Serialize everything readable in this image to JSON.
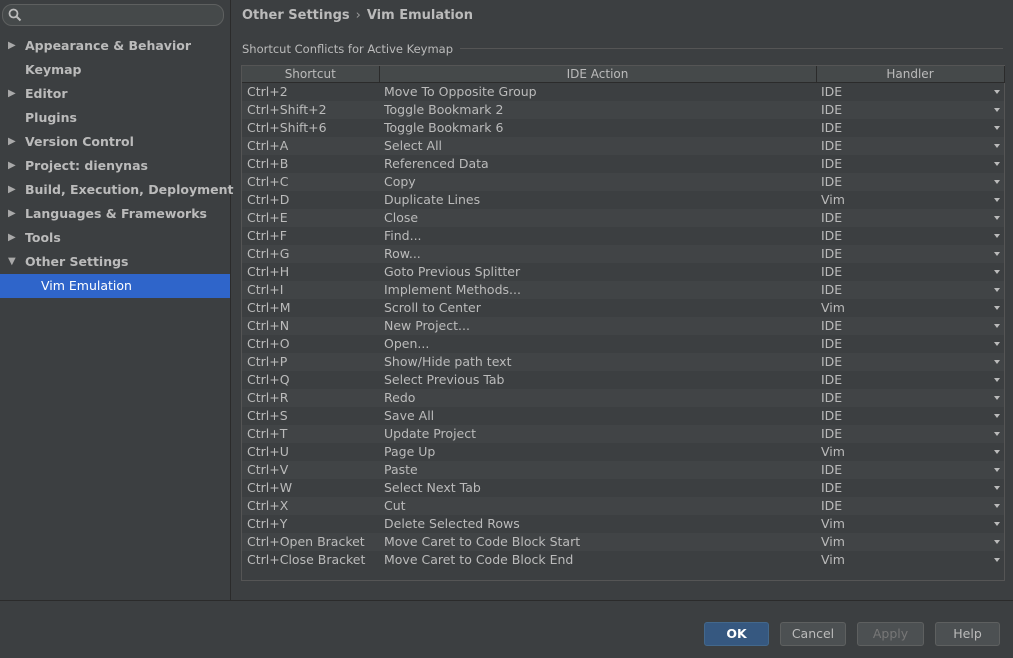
{
  "sidebar": {
    "items": [
      {
        "label": "Appearance & Behavior",
        "arrow": "▶"
      },
      {
        "label": "Keymap",
        "arrow": ""
      },
      {
        "label": "Editor",
        "arrow": "▶"
      },
      {
        "label": "Plugins",
        "arrow": ""
      },
      {
        "label": "Version Control",
        "arrow": "▶"
      },
      {
        "label": "Project: dienynas",
        "arrow": "▶"
      },
      {
        "label": "Build, Execution, Deployment",
        "arrow": "▶"
      },
      {
        "label": "Languages & Frameworks",
        "arrow": "▶"
      },
      {
        "label": "Tools",
        "arrow": "▶"
      },
      {
        "label": "Other Settings",
        "arrow": "▼"
      },
      {
        "label": "Vim Emulation",
        "arrow": ""
      }
    ]
  },
  "breadcrumb": {
    "parent": "Other Settings",
    "separator": "›",
    "current": "Vim Emulation"
  },
  "section_title": "Shortcut Conflicts for Active Keymap",
  "table": {
    "headers": {
      "shortcut": "Shortcut",
      "action": "IDE Action",
      "handler": "Handler"
    },
    "rows": [
      {
        "shortcut": "Ctrl+2",
        "action": "Move To Opposite Group",
        "handler": "IDE"
      },
      {
        "shortcut": "Ctrl+Shift+2",
        "action": "Toggle Bookmark 2",
        "handler": "IDE"
      },
      {
        "shortcut": "Ctrl+Shift+6",
        "action": "Toggle Bookmark 6",
        "handler": "IDE"
      },
      {
        "shortcut": "Ctrl+A",
        "action": "Select All",
        "handler": "IDE"
      },
      {
        "shortcut": "Ctrl+B",
        "action": "Referenced Data",
        "handler": "IDE"
      },
      {
        "shortcut": "Ctrl+C",
        "action": "Copy",
        "handler": "IDE"
      },
      {
        "shortcut": "Ctrl+D",
        "action": "Duplicate Lines",
        "handler": "Vim"
      },
      {
        "shortcut": "Ctrl+E",
        "action": "Close",
        "handler": "IDE"
      },
      {
        "shortcut": "Ctrl+F",
        "action": "Find...",
        "handler": "IDE"
      },
      {
        "shortcut": "Ctrl+G",
        "action": "Row...",
        "handler": "IDE"
      },
      {
        "shortcut": "Ctrl+H",
        "action": "Goto Previous Splitter",
        "handler": "IDE"
      },
      {
        "shortcut": "Ctrl+I",
        "action": "Implement Methods...",
        "handler": "IDE"
      },
      {
        "shortcut": "Ctrl+M",
        "action": "Scroll to Center",
        "handler": "Vim"
      },
      {
        "shortcut": "Ctrl+N",
        "action": "New Project...",
        "handler": "IDE"
      },
      {
        "shortcut": "Ctrl+O",
        "action": "Open...",
        "handler": "IDE"
      },
      {
        "shortcut": "Ctrl+P",
        "action": "Show/Hide path text",
        "handler": "IDE"
      },
      {
        "shortcut": "Ctrl+Q",
        "action": "Select Previous Tab",
        "handler": "IDE"
      },
      {
        "shortcut": "Ctrl+R",
        "action": "Redo",
        "handler": "IDE"
      },
      {
        "shortcut": "Ctrl+S",
        "action": "Save All",
        "handler": "IDE"
      },
      {
        "shortcut": "Ctrl+T",
        "action": "Update Project",
        "handler": "IDE"
      },
      {
        "shortcut": "Ctrl+U",
        "action": "Page Up",
        "handler": "Vim"
      },
      {
        "shortcut": "Ctrl+V",
        "action": "Paste",
        "handler": "IDE"
      },
      {
        "shortcut": "Ctrl+W",
        "action": "Select Next Tab",
        "handler": "IDE"
      },
      {
        "shortcut": "Ctrl+X",
        "action": "Cut",
        "handler": "IDE"
      },
      {
        "shortcut": "Ctrl+Y",
        "action": "Delete Selected Rows",
        "handler": "Vim"
      },
      {
        "shortcut": "Ctrl+Open Bracket",
        "action": "Move Caret to Code Block Start",
        "handler": "Vim"
      },
      {
        "shortcut": "Ctrl+Close Bracket",
        "action": "Move Caret to Code Block End",
        "handler": "Vim"
      }
    ]
  },
  "buttons": {
    "ok": "OK",
    "cancel": "Cancel",
    "apply": "Apply",
    "help": "Help"
  },
  "colors": {
    "selection": "#2f65ca",
    "background": "#3c3f41",
    "ok_button": "#365880"
  },
  "icons": {
    "search": "search-icon",
    "expand": "arrow-right-icon",
    "collapse": "arrow-down-icon",
    "dropdown": "chevron-down-icon"
  }
}
